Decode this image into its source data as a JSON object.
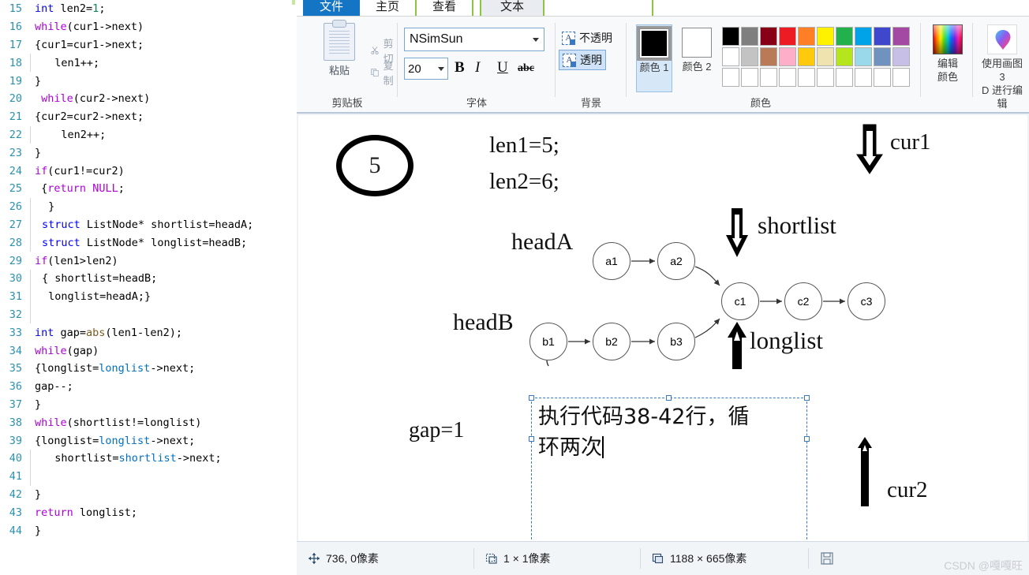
{
  "editor": {
    "lines": [
      {
        "n": "15",
        "indent": 0,
        "tokens": [
          {
            "t": "int",
            "c": "type"
          },
          {
            "t": " len2=",
            "c": ""
          },
          {
            "t": "1",
            "c": "num"
          },
          {
            "t": ";",
            "c": ""
          }
        ]
      },
      {
        "n": "16",
        "indent": 0,
        "tokens": [
          {
            "t": "while",
            "c": "kw"
          },
          {
            "t": "(cur1->next)",
            "c": ""
          }
        ]
      },
      {
        "n": "17",
        "indent": 0,
        "tokens": [
          {
            "t": "{cur1=cur1->next;",
            "c": ""
          }
        ]
      },
      {
        "n": "18",
        "indent": 1,
        "tokens": [
          {
            "t": "  len1++;",
            "c": ""
          }
        ]
      },
      {
        "n": "19",
        "indent": 0,
        "tokens": [
          {
            "t": "}",
            "c": ""
          }
        ]
      },
      {
        "n": "20",
        "indent": 0,
        "tokens": [
          {
            "t": " ",
            "c": ""
          },
          {
            "t": "while",
            "c": "kw"
          },
          {
            "t": "(cur2->next)",
            "c": ""
          }
        ]
      },
      {
        "n": "21",
        "indent": 0,
        "tokens": [
          {
            "t": "{cur2=cur2->next;",
            "c": ""
          }
        ]
      },
      {
        "n": "22",
        "indent": 1,
        "tokens": [
          {
            "t": "   len2++;",
            "c": ""
          }
        ]
      },
      {
        "n": "23",
        "indent": 0,
        "tokens": [
          {
            "t": "}",
            "c": ""
          }
        ]
      },
      {
        "n": "24",
        "indent": 0,
        "tokens": [
          {
            "t": "if",
            "c": "kw"
          },
          {
            "t": "(cur1!=cur2)",
            "c": ""
          }
        ]
      },
      {
        "n": "25",
        "indent": 0,
        "tokens": [
          {
            "t": " {",
            "c": ""
          },
          {
            "t": "return",
            "c": "kw"
          },
          {
            "t": " ",
            "c": ""
          },
          {
            "t": "NULL",
            "c": "kw"
          },
          {
            "t": ";",
            "c": ""
          }
        ]
      },
      {
        "n": "26",
        "indent": 1,
        "tokens": [
          {
            "t": " }",
            "c": ""
          }
        ]
      },
      {
        "n": "27",
        "indent": 1,
        "tokens": [
          {
            "t": "struct",
            "c": "type"
          },
          {
            "t": " ListNode* shortlist=headA;",
            "c": ""
          }
        ]
      },
      {
        "n": "28",
        "indent": 1,
        "tokens": [
          {
            "t": "struct",
            "c": "type"
          },
          {
            "t": " ListNode* longlist=headB;",
            "c": ""
          }
        ]
      },
      {
        "n": "29",
        "indent": 0,
        "tokens": [
          {
            "t": "if",
            "c": "kw"
          },
          {
            "t": "(len1>len2)",
            "c": ""
          }
        ]
      },
      {
        "n": "30",
        "indent": 1,
        "tokens": [
          {
            "t": "{ shortlist=headB;",
            "c": ""
          }
        ]
      },
      {
        "n": "31",
        "indent": 1,
        "tokens": [
          {
            "t": " longlist=headA;}",
            "c": ""
          }
        ]
      },
      {
        "n": "32",
        "indent": 1,
        "tokens": [
          {
            "t": "",
            "c": ""
          }
        ]
      },
      {
        "n": "33",
        "indent": 0,
        "tokens": [
          {
            "t": "int",
            "c": "type"
          },
          {
            "t": " gap=",
            "c": ""
          },
          {
            "t": "abs",
            "c": "fn"
          },
          {
            "t": "(len1-len2);",
            "c": ""
          }
        ]
      },
      {
        "n": "34",
        "indent": 0,
        "tokens": [
          {
            "t": "while",
            "c": "kw"
          },
          {
            "t": "(gap)",
            "c": ""
          }
        ]
      },
      {
        "n": "35",
        "indent": 0,
        "tokens": [
          {
            "t": "{longlist=",
            "c": ""
          },
          {
            "t": "longlist",
            "c": "var"
          },
          {
            "t": "->next;",
            "c": ""
          }
        ]
      },
      {
        "n": "36",
        "indent": 0,
        "tokens": [
          {
            "t": "gap--;",
            "c": ""
          }
        ]
      },
      {
        "n": "37",
        "indent": 0,
        "tokens": [
          {
            "t": "}",
            "c": ""
          }
        ]
      },
      {
        "n": "38",
        "indent": 0,
        "tokens": [
          {
            "t": "while",
            "c": "kw"
          },
          {
            "t": "(shortlist!=longlist)",
            "c": ""
          }
        ]
      },
      {
        "n": "39",
        "indent": 0,
        "tokens": [
          {
            "t": "{longlist=",
            "c": ""
          },
          {
            "t": "longlist",
            "c": "var"
          },
          {
            "t": "->next;",
            "c": ""
          }
        ]
      },
      {
        "n": "40",
        "indent": 1,
        "tokens": [
          {
            "t": "  shortlist=",
            "c": ""
          },
          {
            "t": "shortlist",
            "c": "var"
          },
          {
            "t": "->next;",
            "c": ""
          }
        ]
      },
      {
        "n": "41",
        "indent": 1,
        "tokens": [
          {
            "t": "",
            "c": ""
          }
        ]
      },
      {
        "n": "42",
        "indent": 0,
        "tokens": [
          {
            "t": "}",
            "c": ""
          }
        ]
      },
      {
        "n": "43",
        "indent": 0,
        "tokens": [
          {
            "t": "return",
            "c": "kw"
          },
          {
            "t": " longlist;",
            "c": ""
          }
        ]
      },
      {
        "n": "44",
        "indent": 0,
        "tokens": [
          {
            "t": "}",
            "c": ""
          }
        ]
      }
    ]
  },
  "paint": {
    "tabs": [
      {
        "id": "file",
        "label": "文件"
      },
      {
        "id": "home",
        "label": "主页"
      },
      {
        "id": "view",
        "label": "查看"
      },
      {
        "id": "text",
        "label": "文本"
      }
    ],
    "clipboard": {
      "group_label": "剪贴板",
      "paste_label": "粘贴",
      "cut_label": "剪切",
      "copy_label": "复制"
    },
    "font": {
      "group_label": "字体",
      "font_name": "NSimSun",
      "font_size": "20",
      "bold": "B",
      "italic": "I",
      "underline": "U",
      "strikethrough": "abc"
    },
    "background": {
      "group_label": "背景",
      "opaque_label": "不透明",
      "transparent_label": "透明",
      "selected": "透明"
    },
    "colors": {
      "group_label": "颜色",
      "color1_label": "颜色 1",
      "color2_label": "颜色 2",
      "color1_value": "#000000",
      "color2_value": "#ffffff",
      "edit_colors_label": "编辑\n颜色",
      "edit_colors_line1": "编辑",
      "edit_colors_line2": "颜色",
      "paint3d_line1": "使用画图 3",
      "paint3d_line2": "D 进行编辑",
      "palette_rows": [
        [
          "#000000",
          "#7f7f7f",
          "#880015",
          "#ed1c24",
          "#ff7f27",
          "#fff200",
          "#22b14c",
          "#00a2e8",
          "#3f48cc",
          "#a349a4"
        ],
        [
          "#ffffff",
          "#c3c3c3",
          "#b97a57",
          "#ffaec9",
          "#ffc90e",
          "#efe4b0",
          "#b5e61d",
          "#99d9ea",
          "#7092be",
          "#c8bfe7"
        ],
        [
          "#ffffff",
          "#ffffff",
          "#ffffff",
          "#ffffff",
          "#ffffff",
          "#ffffff",
          "#ffffff",
          "#ffffff",
          "#ffffff",
          "#ffffff"
        ]
      ]
    },
    "status": {
      "cursor_position": "736, 0像素",
      "selection_size": "1 × 1像素",
      "image_size": "1188 × 665像素",
      "watermark": "CSDN @嘎嘎旺"
    }
  },
  "canvas": {
    "circle_number": "5",
    "len1": "len1=5;",
    "len2": "len2=6;",
    "headA": "headA",
    "headB": "headB",
    "gap": "gap=1",
    "cur1": "cur1",
    "cur2": "cur2",
    "shortlist": "shortlist",
    "longlist": "longlist",
    "nodes": [
      {
        "id": "a1",
        "label": "a1"
      },
      {
        "id": "a2",
        "label": "a2"
      },
      {
        "id": "b1",
        "label": "b1"
      },
      {
        "id": "b2",
        "label": "b2"
      },
      {
        "id": "b3",
        "label": "b3"
      },
      {
        "id": "c1",
        "label": "c1"
      },
      {
        "id": "c2",
        "label": "c2"
      },
      {
        "id": "c3",
        "label": "c3"
      }
    ],
    "textbox": {
      "line1": "执行代码38-42行，循",
      "line2": "环两次"
    }
  }
}
